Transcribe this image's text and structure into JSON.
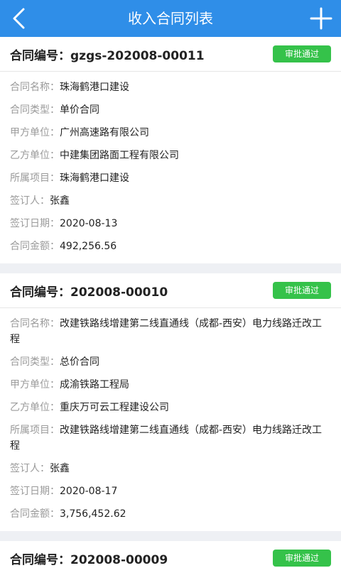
{
  "header": {
    "title": "收入合同列表"
  },
  "labels": {
    "code": "合同编号：",
    "name": "合同名称：",
    "type": "合同类型：",
    "party_a": "甲方单位：",
    "party_b": "乙方单位：",
    "project": "所属项目：",
    "signer": "签订人：",
    "date": "签订日期：",
    "amount": "合同金额："
  },
  "contracts": [
    {
      "code": "gzgs-202008-00011",
      "status": "审批通过",
      "name": "珠海鹤港口建设",
      "type": "单价合同",
      "party_a": "广州高速路有限公司",
      "party_b": "中建集团路面工程有限公司",
      "project": "珠海鹤港口建设",
      "signer": "张鑫",
      "date": "2020-08-13",
      "amount": "492,256.56"
    },
    {
      "code": "202008-00010",
      "status": "审批通过",
      "name": "改建铁路线增建第二线直通线（成都-西安）电力线路迁改工程",
      "type": "总价合同",
      "party_a": "成渝铁路工程局",
      "party_b": "重庆万可云工程建设公司",
      "project": "改建铁路线增建第二线直通线（成都-西安）电力线路迁改工程",
      "signer": "张鑫",
      "date": "2020-08-17",
      "amount": "3,756,452.62"
    },
    {
      "code": "202008-00009",
      "status": "审批通过"
    }
  ],
  "colors": {
    "header": "#2f8ee8",
    "badge": "#35c24a",
    "label": "#9a9a9a",
    "value": "#222222"
  },
  "icons": {
    "back": "chevron-left-icon",
    "add": "plus-icon"
  }
}
